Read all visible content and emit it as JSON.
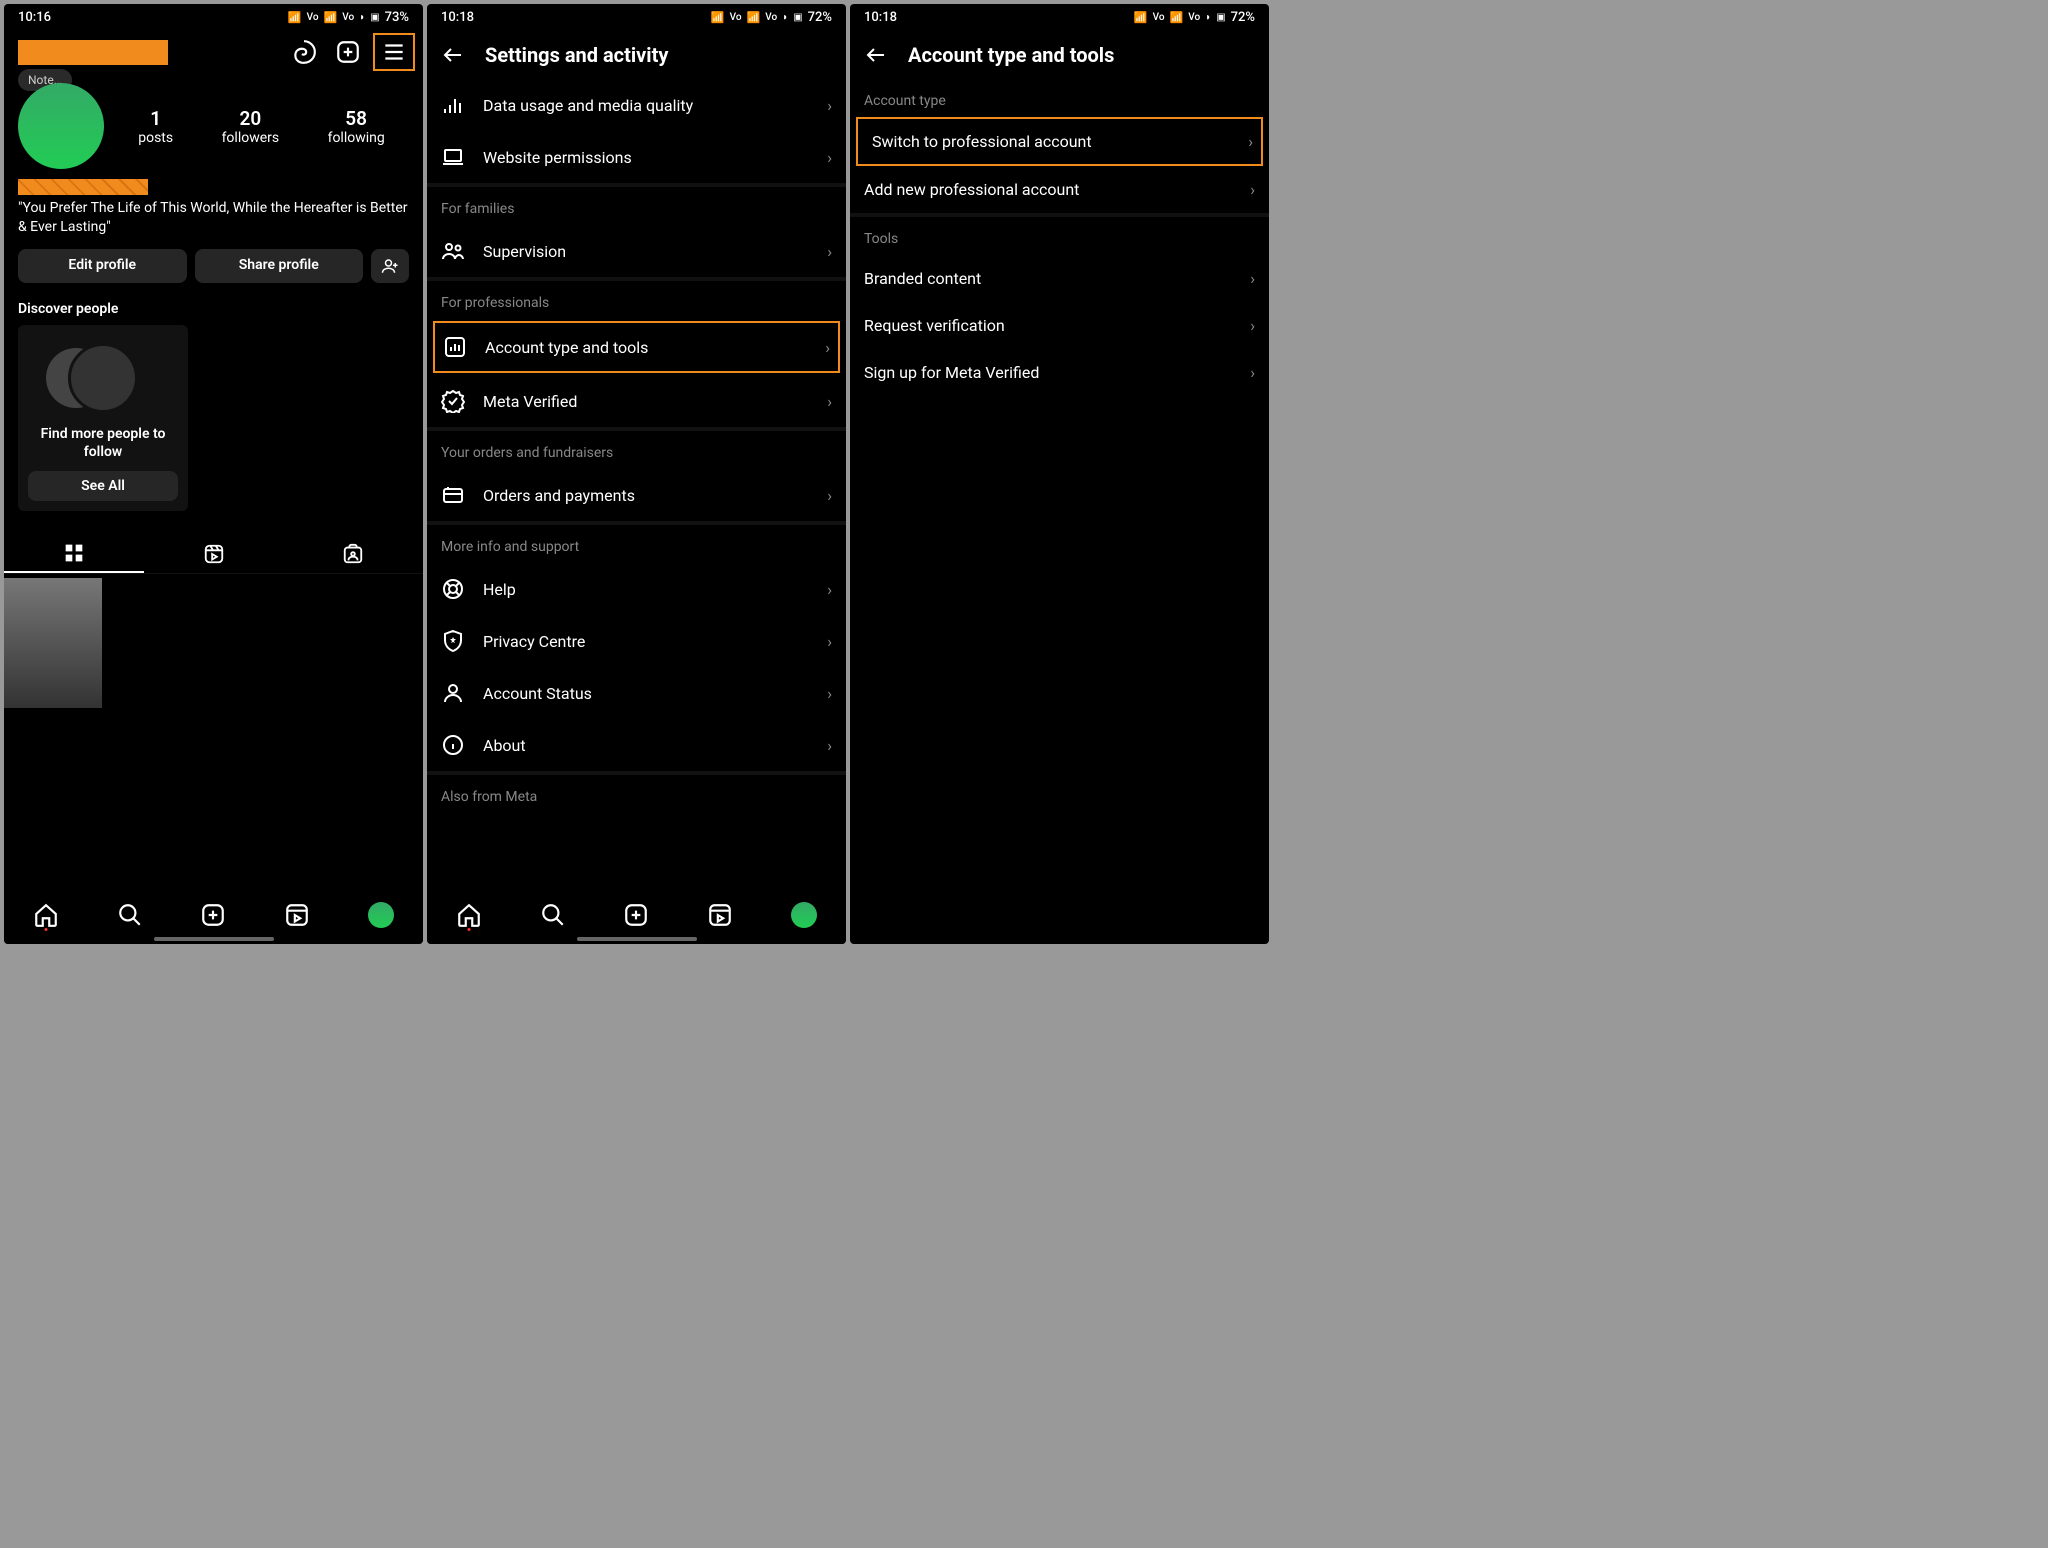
{
  "status": {
    "time_a": "10:16",
    "time_b": "10:18",
    "time_c": "10:18",
    "battery_a": "73%",
    "battery_b": "72%",
    "battery_c": "72%",
    "net": "WiFi",
    "vo": "Vo"
  },
  "profile": {
    "note": "Note…",
    "posts_n": "1",
    "posts_l": "posts",
    "followers_n": "20",
    "followers_l": "followers",
    "following_n": "58",
    "following_l": "following",
    "bio": "\"You Prefer The Life of This World, While the Hereafter is Better & Ever Lasting\"",
    "edit": "Edit profile",
    "share": "Share profile",
    "discover_hdr": "Discover people",
    "discover_txt": "Find more people to follow",
    "see_all": "See All"
  },
  "settings": {
    "title": "Settings and activity",
    "data_usage": "Data usage and media quality",
    "web_perm": "Website permissions",
    "families": "For families",
    "supervision": "Supervision",
    "professionals": "For professionals",
    "acct_type": "Account type and tools",
    "meta_ver": "Meta Verified",
    "orders_hdr": "Your orders and fundraisers",
    "orders": "Orders and payments",
    "more_hdr": "More info and support",
    "help": "Help",
    "privacy": "Privacy Centre",
    "status": "Account Status",
    "about": "About",
    "also": "Also from Meta"
  },
  "acct": {
    "title": "Account type and tools",
    "type_hdr": "Account type",
    "switch": "Switch to professional account",
    "add_new": "Add new professional account",
    "tools_hdr": "Tools",
    "branded": "Branded content",
    "verify": "Request verification",
    "signup": "Sign up for Meta Verified"
  }
}
